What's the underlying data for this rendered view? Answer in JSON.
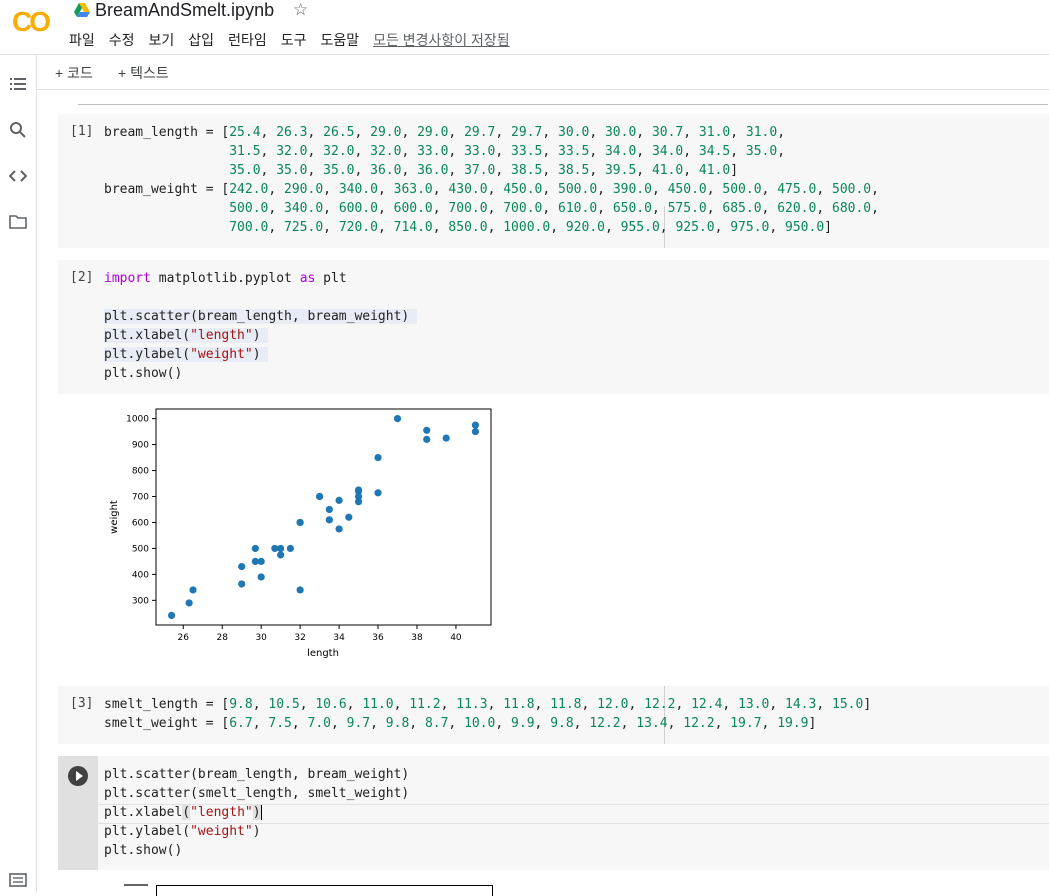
{
  "app": {
    "logo_text": "CO",
    "title": "BreamAndSmelt.ipynb",
    "menu": [
      "파일",
      "수정",
      "보기",
      "삽입",
      "런타임",
      "도구",
      "도움말"
    ],
    "saved_status": "모든 변경사항이 저장됨"
  },
  "toolbar": {
    "add_code": "+ 코드",
    "add_text": "+ 텍스트"
  },
  "sidebar": {
    "icons": [
      "toc-icon",
      "search-icon",
      "code-snippets-icon",
      "folder-icon"
    ],
    "bottom_icon": "terminal-icon"
  },
  "cells": [
    {
      "exec": "[1]"
    },
    {
      "exec": "[2]"
    },
    {
      "exec": "[3]"
    },
    {
      "exec": ""
    }
  ],
  "chart_data": {
    "type": "scatter",
    "xlabel": "length",
    "ylabel": "weight",
    "xticks": [
      26,
      28,
      30,
      32,
      34,
      36,
      38,
      40
    ],
    "yticks": [
      300,
      400,
      500,
      600,
      700,
      800,
      900,
      1000
    ],
    "xlim": [
      24.6,
      41.8
    ],
    "ylim": [
      205,
      1037
    ],
    "color": "#1f77b4",
    "x": [
      25.4,
      26.3,
      26.5,
      29.0,
      29.0,
      29.7,
      29.7,
      30.0,
      30.0,
      30.7,
      31.0,
      31.0,
      31.5,
      32.0,
      32.0,
      32.0,
      33.0,
      33.0,
      33.5,
      33.5,
      34.0,
      34.0,
      34.5,
      35.0,
      35.0,
      35.0,
      35.0,
      36.0,
      36.0,
      37.0,
      38.5,
      38.5,
      39.5,
      41.0,
      41.0
    ],
    "y": [
      242.0,
      290.0,
      340.0,
      363.0,
      430.0,
      450.0,
      500.0,
      390.0,
      450.0,
      500.0,
      475.0,
      500.0,
      500.0,
      340.0,
      600.0,
      600.0,
      700.0,
      700.0,
      610.0,
      650.0,
      575.0,
      685.0,
      620.0,
      680.0,
      700.0,
      725.0,
      720.0,
      714.0,
      850.0,
      1000.0,
      920.0,
      955.0,
      925.0,
      975.0,
      950.0
    ]
  }
}
